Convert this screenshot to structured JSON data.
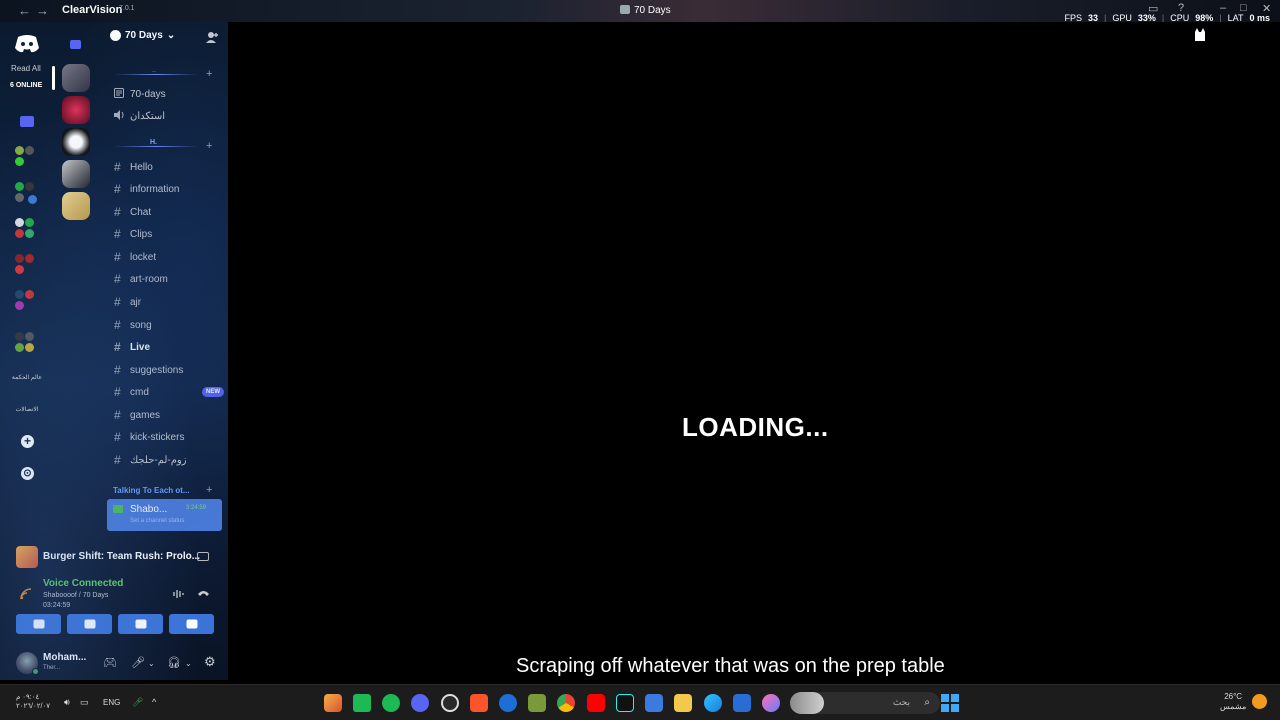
{
  "titlebar": {
    "back": "←",
    "forward": "→",
    "app_name": "ClearVision",
    "app_version": "7.0.1",
    "window_title": "70 Days"
  },
  "stats": {
    "fps_label": "FPS",
    "fps_value": "33",
    "gpu_label": "GPU",
    "gpu_value": "33%",
    "cpu_label": "CPU",
    "cpu_value": "98%",
    "lat_label": "LAT",
    "lat_value": "0 ms"
  },
  "rail": {
    "read_all": "Read All",
    "online": "6 ONLINE",
    "text_icons": [
      "عالم الحكمة",
      "الاتصالات"
    ],
    "add_server": "+",
    "explore": "⊙"
  },
  "server": {
    "name": "70 Days",
    "dropdown": "⌄"
  },
  "channel_groups": {
    "top_label": "..",
    "h_label": "H."
  },
  "channels": [
    {
      "name": "70-days",
      "kind": "rules"
    },
    {
      "name": "استكدان",
      "kind": "voice"
    },
    {
      "name": "Hello",
      "kind": "text"
    },
    {
      "name": "information",
      "kind": "text"
    },
    {
      "name": "Chat",
      "kind": "text"
    },
    {
      "name": "Clips",
      "kind": "text"
    },
    {
      "name": "locket",
      "kind": "text"
    },
    {
      "name": "art-room",
      "kind": "text"
    },
    {
      "name": "ajr",
      "kind": "text"
    },
    {
      "name": "song",
      "kind": "text"
    },
    {
      "name": "Live",
      "kind": "text"
    },
    {
      "name": "suggestions",
      "kind": "text"
    },
    {
      "name": "cmd",
      "kind": "text"
    },
    {
      "name": "games",
      "kind": "text"
    },
    {
      "name": "kick-stickers",
      "kind": "text"
    },
    {
      "name": "زوم-لم-حلجك",
      "kind": "text"
    }
  ],
  "new_badge": "NEW",
  "voice_category": "Talking To Each ot...",
  "voice_channel": {
    "name": "Shabo...",
    "time": "3:24:59",
    "sub": "Set a channel status"
  },
  "activity": {
    "game": "Burger Shift: Team Rush: Prolo..."
  },
  "voice_panel": {
    "status": "Voice Connected",
    "path": "Shaboooof / 70 Days",
    "time": "03:24:59"
  },
  "user": {
    "name": "Moham...",
    "status": "Ther..."
  },
  "main": {
    "loading": "LOADING...",
    "subtitle": "Scraping off whatever that was on the prep table"
  },
  "taskbar": {
    "time": "٠٩:٠٤ م",
    "date": "٢٠٢٦/٠٢/٠٧",
    "lang": "ENG",
    "caret": "^",
    "search_text": "بحث",
    "weather_temp": "26°C",
    "weather_text": "مشمس"
  },
  "colors": {
    "accent": "#5865f2",
    "voice_green": "#5fd35f",
    "voice_selected": "#4a7bd8"
  }
}
